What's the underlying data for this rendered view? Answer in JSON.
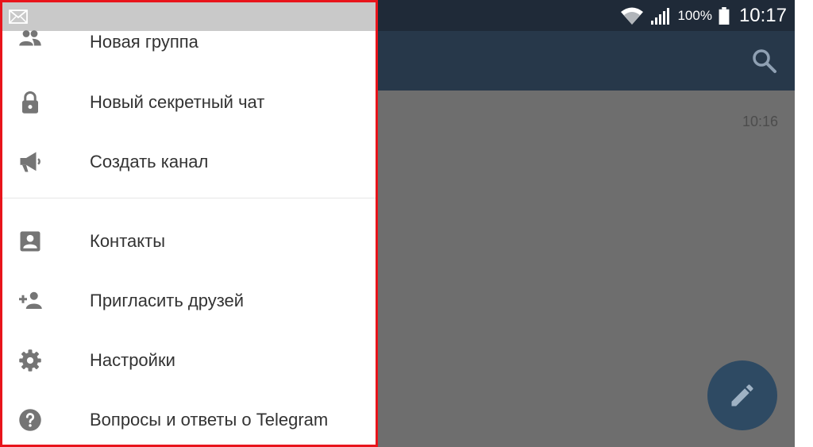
{
  "status_bar": {
    "battery_percent": "100%",
    "time": "10:17"
  },
  "chat_list": {
    "last_time": "10:16"
  },
  "drawer": {
    "items": [
      {
        "label": "Новая группа",
        "icon": "group-icon"
      },
      {
        "label": "Новый секретный чат",
        "icon": "lock-icon"
      },
      {
        "label": "Создать канал",
        "icon": "megaphone-icon"
      },
      {
        "label": "Контакты",
        "icon": "contact-card-icon"
      },
      {
        "label": "Пригласить друзей",
        "icon": "add-person-icon"
      },
      {
        "label": "Настройки",
        "icon": "gear-icon"
      },
      {
        "label": "Вопросы и ответы о Telegram",
        "icon": "help-icon"
      }
    ]
  },
  "colors": {
    "highlight_border": "#e8141b",
    "app_bar": "#27384a",
    "fab": "#2e4a63"
  }
}
